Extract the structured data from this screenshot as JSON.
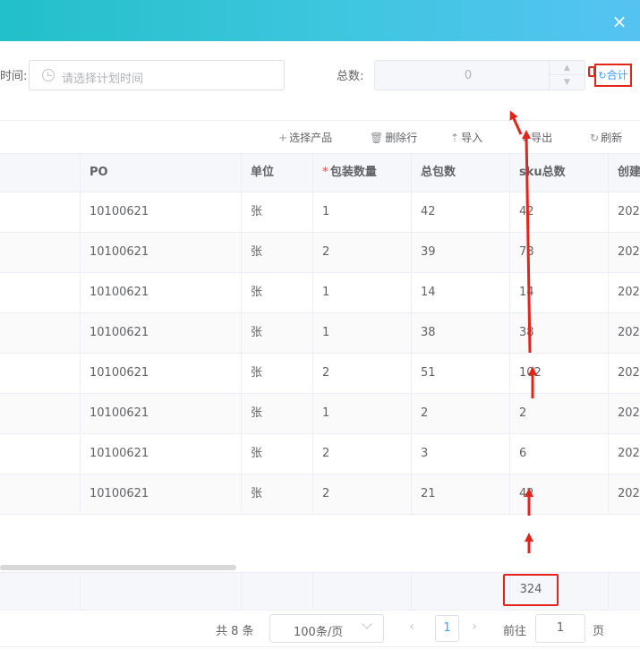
{
  "dialog": {
    "close_icon": "×"
  },
  "form": {
    "time_label": "时间:",
    "time_placeholder": "请选择计划时间",
    "total_label": "总数:",
    "total_value": "0",
    "sum_button": "合计"
  },
  "toolbar": {
    "select_product": "选择产品",
    "delete_row": "删除行",
    "import": "导入",
    "export": "导出",
    "refresh": "刷新"
  },
  "table": {
    "columns": [
      "PO",
      "单位",
      "包装数量",
      "总包数",
      "sku总数",
      "创建"
    ],
    "required_column_marker": "*",
    "rows": [
      [
        "10100621",
        "张",
        "1",
        "42",
        "42",
        "202"
      ],
      [
        "10100621",
        "张",
        "2",
        "39",
        "78",
        "202"
      ],
      [
        "10100621",
        "张",
        "1",
        "14",
        "14",
        "202"
      ],
      [
        "10100621",
        "张",
        "1",
        "38",
        "38",
        "202"
      ],
      [
        "10100621",
        "张",
        "2",
        "51",
        "102",
        "202"
      ],
      [
        "10100621",
        "张",
        "1",
        "2",
        "2",
        "202"
      ],
      [
        "10100621",
        "张",
        "2",
        "3",
        "6",
        "202"
      ],
      [
        "10100621",
        "张",
        "2",
        "21",
        "42",
        "202"
      ]
    ],
    "sum_value": "324"
  },
  "pager": {
    "total_text": "共 8 条",
    "page_size": "100条/页",
    "current_page": "1",
    "goto_label": "前往",
    "goto_value": "1",
    "page_suffix": "页"
  },
  "colors": {
    "header_gradient_start": "#22c0c8",
    "header_gradient_end": "#55c3f2",
    "annotation_red": "#e1251b",
    "link_blue": "#409eff"
  }
}
